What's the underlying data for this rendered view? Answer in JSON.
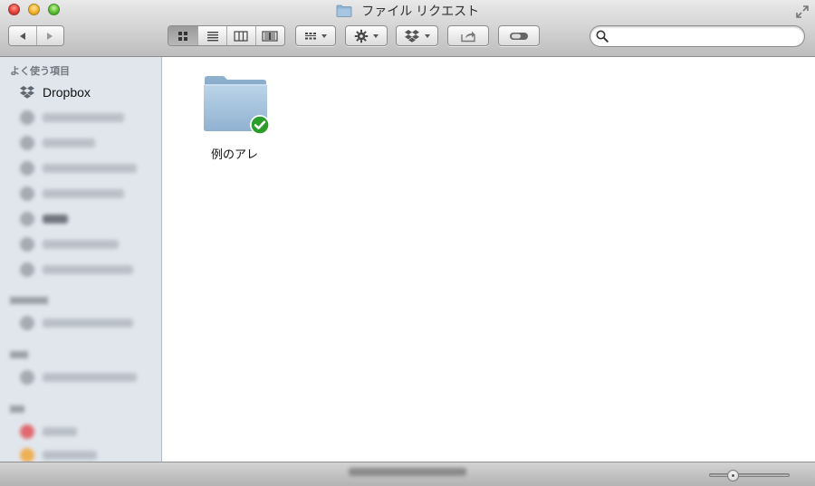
{
  "window": {
    "title": "ファイル リクエスト",
    "icons": {
      "title": "folder-icon",
      "fullscreen": "fullscreen-arrows-icon"
    }
  },
  "toolbar": {
    "nav": {
      "back_icon": "back-arrow-icon",
      "forward_icon": "forward-arrow-icon"
    },
    "view_modes": [
      {
        "id": "icon",
        "icon": "icon-view-icon",
        "active": true
      },
      {
        "id": "list",
        "icon": "list-view-icon",
        "active": false
      },
      {
        "id": "column",
        "icon": "column-view-icon",
        "active": false
      },
      {
        "id": "coverflow",
        "icon": "coverflow-view-icon",
        "active": false
      }
    ],
    "arrange_icon": "arrange-icon",
    "action_icon": "gear-icon",
    "dropbox_icon": "dropbox-icon",
    "share_icon": "share-icon",
    "tags_icon": "tag-toggle-icon",
    "search": {
      "placeholder": "",
      "value": "",
      "icon": "search-icon"
    }
  },
  "sidebar": {
    "favorites_header": "よく使う項目",
    "items": [
      {
        "label": "Dropbox",
        "icon": "dropbox-icon"
      }
    ]
  },
  "content": {
    "items": [
      {
        "label": "例のアレ",
        "icon": "folder-icon",
        "badge": "synced-check-icon"
      }
    ]
  },
  "colors": {
    "sidebar_bg": "#e1e6ed",
    "folder_blue": "#8fb4d4",
    "sync_green": "#2a9d2a"
  },
  "statusbar": {
    "zoom_slider_value": 0.25
  }
}
